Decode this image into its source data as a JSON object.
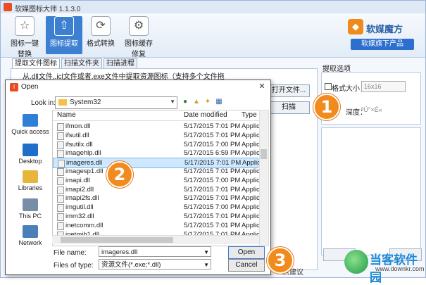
{
  "app": {
    "title": "软媒图标大师 1.1.3.0"
  },
  "ribbon": {
    "buttons": [
      {
        "label": "图标一键\n替换",
        "icon": "star-icon"
      },
      {
        "label": "图标提取",
        "icon": "upload-icon"
      },
      {
        "label": "格式转换",
        "icon": "refresh-icon"
      },
      {
        "label": "图标缓存\n修复",
        "icon": "gear-icon"
      }
    ],
    "brand": "软媒魔方",
    "brand_button": "软媒旗下产品"
  },
  "main": {
    "tabs": [
      "提取文件图标",
      "扫描文件夹",
      "扫描进程"
    ],
    "description": "从.dll文件,.icl文件或者.exe文件中提取资源图标（支持多个文件拖",
    "open_file_button": "打开文件...",
    "scan_button": "扫描",
    "options_title": "提取选项",
    "format_size_label": "格式大小：",
    "size_value": "16x16",
    "depth_label": "深度：",
    "depth_value": "ºÜ°×É«",
    "footer_text": "点建议"
  },
  "dialog": {
    "title": "Open",
    "look_in_label": "Look in:",
    "look_in_value": "System32",
    "places": [
      "Quick access",
      "Desktop",
      "Libraries",
      "This PC",
      "Network"
    ],
    "columns": [
      "Name",
      "Date modified",
      "Type"
    ],
    "files": [
      {
        "name": "ifmon.dll",
        "date": "5/17/2015 7:01 PM",
        "type": "Applic"
      },
      {
        "name": "ifsutil.dll",
        "date": "5/17/2015 7:01 PM",
        "type": "Applic"
      },
      {
        "name": "ifsutilx.dll",
        "date": "5/17/2015 7:00 PM",
        "type": "Applic"
      },
      {
        "name": "imagehlp.dll",
        "date": "5/17/2015 6:59 PM",
        "type": "Applic"
      },
      {
        "name": "imageres.dll",
        "date": "5/17/2015 7:01 PM",
        "type": "Applic"
      },
      {
        "name": "imagesp1.dll",
        "date": "5/17/2015 7:01 PM",
        "type": "Applic"
      },
      {
        "name": "imapi.dll",
        "date": "5/17/2015 7:00 PM",
        "type": "Applic"
      },
      {
        "name": "imapi2.dll",
        "date": "5/17/2015 7:01 PM",
        "type": "Applic"
      },
      {
        "name": "imapi2fs.dll",
        "date": "5/17/2015 7:01 PM",
        "type": "Applic"
      },
      {
        "name": "imgutil.dll",
        "date": "5/17/2015 7:00 PM",
        "type": "Applic"
      },
      {
        "name": "imm32.dll",
        "date": "5/17/2015 7:01 PM",
        "type": "Applic"
      },
      {
        "name": "inetcomm.dll",
        "date": "5/17/2015 7:01 PM",
        "type": "Applic"
      },
      {
        "name": "inetmib1.dll",
        "date": "5/17/2015 7:01 PM",
        "type": "Applic"
      }
    ],
    "file_name_label": "File name:",
    "file_name_value": "imageres.dll",
    "file_type_label": "Files of type:",
    "file_type_value": "资源文件(*.exe;*.dll)",
    "open_button": "Open",
    "cancel_button": "Cancel"
  },
  "badges": [
    "1",
    "2",
    "3"
  ],
  "watermark": {
    "title": "当客软件园",
    "url": "www.downkr.com"
  },
  "colors": {
    "accent": "#3d7fd1",
    "badge": "#f28b1e",
    "selection": "#cde8ff"
  }
}
